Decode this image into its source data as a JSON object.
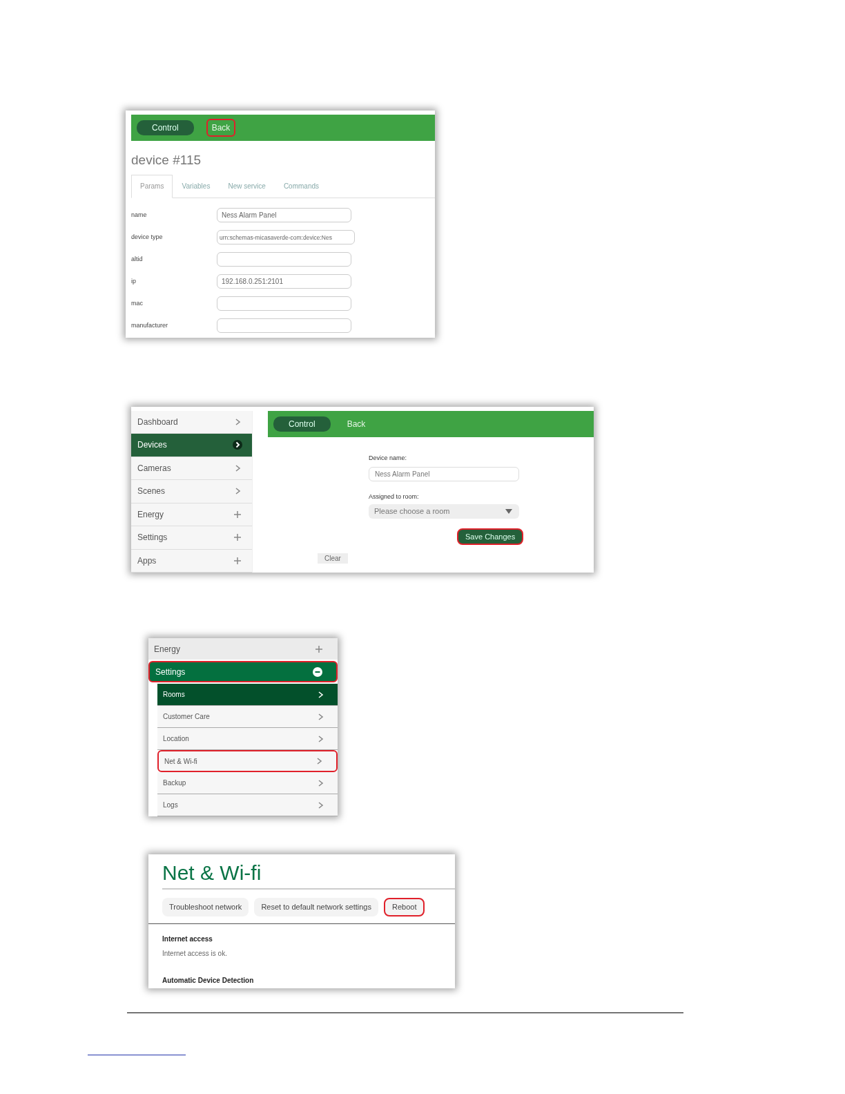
{
  "panels": [
    {
      "kind": "device_params",
      "toolbar": [
        {
          "label": "Control",
          "kind": "pill",
          "highlighted": false
        },
        {
          "label": "Back",
          "kind": "link",
          "highlighted": true
        }
      ],
      "title": "device #115",
      "tabs": [
        {
          "label": "Params",
          "selected": true
        },
        {
          "label": "Variables",
          "selected": false
        },
        {
          "label": "New service",
          "selected": false
        },
        {
          "label": "Commands",
          "selected": false
        }
      ],
      "fields": [
        {
          "label": "name",
          "value": "Ness Alarm Panel"
        },
        {
          "label": "device type",
          "value": "urn:schemas-micasaverde-com:device:Nes"
        },
        {
          "label": "altid"
        },
        {
          "label": "ip",
          "value": "192.168.0.251:2101"
        },
        {
          "label": "mac"
        },
        {
          "label": "manufacturer"
        }
      ]
    },
    {
      "kind": "device_edit",
      "sidebar": [
        {
          "label": "Dashboard",
          "kind": "link",
          "selected": false
        },
        {
          "label": "Devices",
          "kind": "link",
          "selected": true
        },
        {
          "label": "Cameras",
          "kind": "link",
          "selected": false
        },
        {
          "label": "Scenes",
          "kind": "link",
          "selected": false
        },
        {
          "label": "Energy",
          "kind": "group",
          "selected": false
        },
        {
          "label": "Settings",
          "kind": "group",
          "selected": false
        },
        {
          "label": "Apps",
          "kind": "group",
          "selected": false
        }
      ],
      "toolbar": [
        {
          "label": "Control",
          "kind": "pill",
          "highlighted": false
        },
        {
          "label": "Back",
          "kind": "link",
          "highlighted": false
        }
      ],
      "name_label": "Device name:",
      "name_value": "Ness Alarm Panel",
      "room_label": "Assigned to room:",
      "room_placeholder": "Please choose a room",
      "save": {
        "label": "Save Changes",
        "highlighted": true
      },
      "clear": "Clear"
    },
    {
      "kind": "settings_menu",
      "items": [
        {
          "label": "Energy",
          "expanded": false,
          "highlighted": false
        },
        {
          "label": "Settings",
          "expanded": true,
          "highlighted": true,
          "children": [
            {
              "label": "Rooms",
              "selected": true,
              "highlighted": false
            },
            {
              "label": "Customer Care",
              "selected": false,
              "highlighted": false
            },
            {
              "label": "Location",
              "selected": false,
              "highlighted": false
            },
            {
              "label": "Net & Wi-fi",
              "selected": false,
              "highlighted": true
            },
            {
              "label": "Backup",
              "selected": false,
              "highlighted": false
            },
            {
              "label": "Logs",
              "selected": false,
              "highlighted": false
            }
          ]
        }
      ]
    },
    {
      "kind": "network",
      "title": "Net & Wi-fi",
      "buttons": [
        {
          "label": "Troubleshoot network",
          "highlighted": false
        },
        {
          "label": "Reset to default network settings",
          "highlighted": false
        },
        {
          "label": "Reboot",
          "highlighted": true
        }
      ],
      "sections": [
        {
          "heading": "Internet access",
          "text": "Internet access is ok."
        },
        {
          "heading": "Automatic Device Detection"
        }
      ]
    }
  ]
}
